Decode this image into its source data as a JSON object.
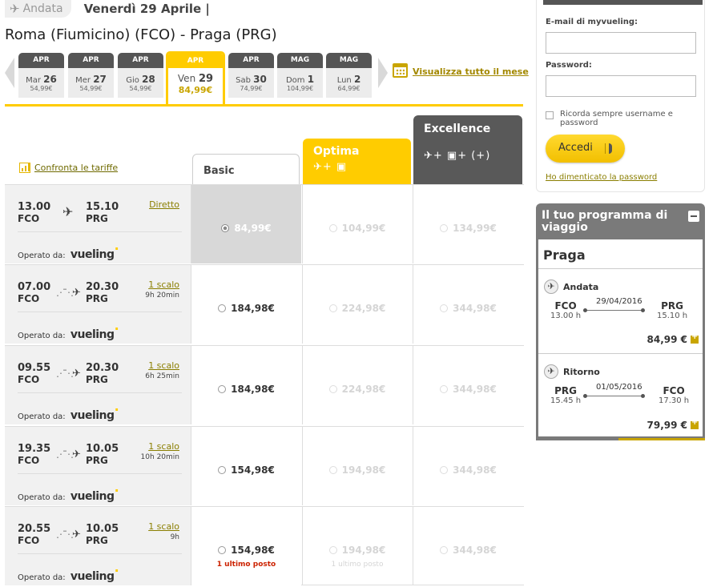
{
  "header": {
    "andata_label": "Andata",
    "date_label": "Venerdì 29 Aprile |",
    "route": "Roma (Fiumicino) (FCO) - Praga (PRG)"
  },
  "dates": [
    {
      "month": "APR",
      "weekday": "Mar",
      "day": "26",
      "price": "54,99€"
    },
    {
      "month": "APR",
      "weekday": "Mer",
      "day": "27",
      "price": "54,99€"
    },
    {
      "month": "APR",
      "weekday": "Gio",
      "day": "28",
      "price": "54,99€"
    },
    {
      "month": "APR",
      "weekday": "Ven",
      "day": "29",
      "price": "84,99€",
      "selected": true
    },
    {
      "month": "APR",
      "weekday": "Sab",
      "day": "30",
      "price": "74,99€"
    },
    {
      "month": "MAG",
      "weekday": "Dom",
      "day": "1",
      "price": "104,99€"
    },
    {
      "month": "MAG",
      "weekday": "Lun",
      "day": "2",
      "price": "64,99€"
    }
  ],
  "view_month_link": "Visualizza tutto il mese",
  "compare_link": "Confronta le tariffe",
  "fares": {
    "basic": "Basic",
    "optima": "Optima",
    "optima_icons": "✈+ ▣",
    "excellence": "Excellence",
    "excellence_icons": "✈+ ▣+ (+)"
  },
  "operated_by": "Operato da:",
  "carrier": "vueling",
  "flights": [
    {
      "dep_time": "13.00",
      "dep": "FCO",
      "arr_time": "15.10",
      "arr": "PRG",
      "stops": "Diretto",
      "duration": "",
      "basic": "84,99€",
      "optima": "104,99€",
      "excellence": "134,99€",
      "selected": true,
      "basic_note": "",
      "optima_note": ""
    },
    {
      "dep_time": "07.00",
      "dep": "FCO",
      "arr_time": "20.30",
      "arr": "PRG",
      "stops": "1 scalo",
      "duration": "9h 20min",
      "basic": "184,98€",
      "optima": "224,98€",
      "excellence": "344,98€",
      "basic_note": "",
      "optima_note": ""
    },
    {
      "dep_time": "09.55",
      "dep": "FCO",
      "arr_time": "20.30",
      "arr": "PRG",
      "stops": "1 scalo",
      "duration": "6h 25min",
      "basic": "184,98€",
      "optima": "224,98€",
      "excellence": "344,98€",
      "basic_note": "",
      "optima_note": ""
    },
    {
      "dep_time": "19.35",
      "dep": "FCO",
      "arr_time": "10.05",
      "arr": "PRG",
      "stops": "1 scalo",
      "duration": "10h 20min",
      "basic": "154,98€",
      "optima": "194,98€",
      "excellence": "344,98€",
      "basic_note": "",
      "optima_note": ""
    },
    {
      "dep_time": "20.55",
      "dep": "FCO",
      "arr_time": "10.05",
      "arr": "PRG",
      "stops": "1 scalo",
      "duration": "9h",
      "basic": "154,98€",
      "optima": "194,98€",
      "excellence": "344,98€",
      "basic_note": "1 ultimo posto",
      "optima_note": "1 ultimo posto"
    }
  ],
  "login": {
    "email_label": "E-mail di myvueling:",
    "password_label": "Password:",
    "remember": "Ricorda sempre username e password",
    "login_button": "Accedi",
    "forgot": "Ho dimenticato la password"
  },
  "trip": {
    "title": "Il tuo programma di viaggio",
    "city": "Praga",
    "outbound": {
      "label": "Andata",
      "from": "FCO",
      "from_time": "13.00 h",
      "date": "29/04/2016",
      "to": "PRG",
      "to_time": "15.10 h",
      "price": "84,99 €"
    },
    "return": {
      "label": "Ritorno",
      "from": "PRG",
      "from_time": "15.45 h",
      "date": "01/05/2016",
      "to": "FCO",
      "to_time": "17.30 h",
      "price": "79,99 €"
    }
  },
  "colors": {
    "accent": "#ffcc00",
    "dark": "#595959"
  }
}
